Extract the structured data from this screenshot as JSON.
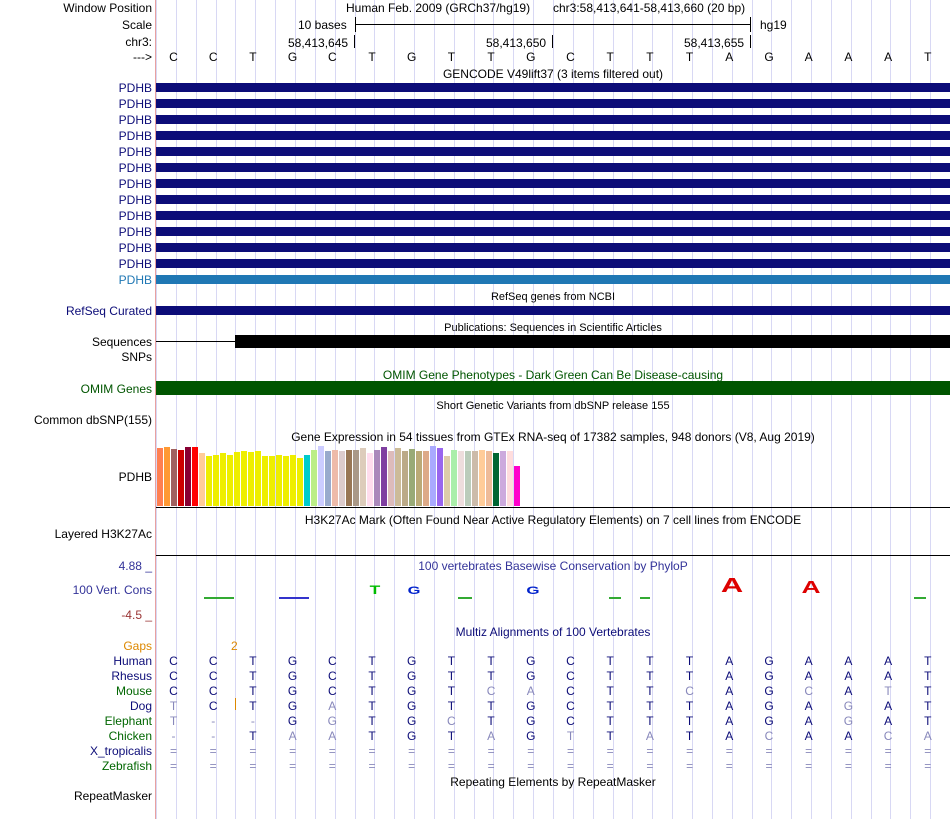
{
  "header": {
    "window_position_label": "Window Position",
    "scale_label": "Scale",
    "chr_label": "chr3:",
    "arrow_label": "--->",
    "assembly": "Human Feb. 2009 (GRCh37/hg19)",
    "region": "chr3:58,413,641-58,413,660 (20 bp)",
    "scale_text": "10 bases",
    "db": "hg19",
    "positions": [
      "58,413,645",
      "58,413,650",
      "58,413,655"
    ]
  },
  "bases": [
    "C",
    "C",
    "T",
    "G",
    "C",
    "T",
    "G",
    "T",
    "T",
    "G",
    "C",
    "T",
    "T",
    "T",
    "A",
    "G",
    "A",
    "A",
    "A",
    "T"
  ],
  "gencode": {
    "title": "GENCODE V49lift37 (3 items filtered out)",
    "items": [
      "PDHB",
      "PDHB",
      "PDHB",
      "PDHB",
      "PDHB",
      "PDHB",
      "PDHB",
      "PDHB",
      "PDHB",
      "PDHB",
      "PDHB",
      "PDHB",
      "PDHB"
    ]
  },
  "refseq": {
    "title": "RefSeq genes from NCBI",
    "label": "RefSeq Curated"
  },
  "publications": {
    "title": "Publications: Sequences in Scientific Articles",
    "label": "Sequences"
  },
  "snps": {
    "label": "SNPs"
  },
  "omim": {
    "title": "OMIM Gene Phenotypes - Dark Green Can Be Disease-causing",
    "label": "OMIM Genes"
  },
  "dbsnp": {
    "title": "Short Genetic Variants from dbSNP release 155",
    "label": "Common dbSNP(155)"
  },
  "gtex": {
    "title": "Gene Expression in 54 tissues from GTEx RNA-seq of 17382 samples, 948 donors (V8, Aug 2019)",
    "label": "PDHB",
    "bars": [
      {
        "color": "#ff7f50",
        "value": 0.93
      },
      {
        "color": "#ff9933",
        "value": 0.95
      },
      {
        "color": "#a06060",
        "value": 0.92
      },
      {
        "color": "#cc0000",
        "value": 0.9
      },
      {
        "color": "#880033",
        "value": 0.95
      },
      {
        "color": "#ff0000",
        "value": 0.95
      },
      {
        "color": "#ffcc99",
        "value": 0.85
      },
      {
        "color": "#eeee00",
        "value": 0.8
      },
      {
        "color": "#eeee00",
        "value": 0.82
      },
      {
        "color": "#eeee00",
        "value": 0.85
      },
      {
        "color": "#eeee00",
        "value": 0.82
      },
      {
        "color": "#eeee00",
        "value": 0.87
      },
      {
        "color": "#eeee00",
        "value": 0.88
      },
      {
        "color": "#eeee00",
        "value": 0.87
      },
      {
        "color": "#eeee00",
        "value": 0.88
      },
      {
        "color": "#eeee00",
        "value": 0.8
      },
      {
        "color": "#eeee00",
        "value": 0.8
      },
      {
        "color": "#eeee00",
        "value": 0.82
      },
      {
        "color": "#eeee00",
        "value": 0.8
      },
      {
        "color": "#eeee00",
        "value": 0.82
      },
      {
        "color": "#eeee00",
        "value": 0.78
      },
      {
        "color": "#00cccc",
        "value": 0.82
      },
      {
        "color": "#bbee88",
        "value": 0.9
      },
      {
        "color": "#ccccff",
        "value": 0.97
      },
      {
        "color": "#99aacc",
        "value": 0.88
      },
      {
        "color": "#eebbaa",
        "value": 0.9
      },
      {
        "color": "#ddcccc",
        "value": 0.88
      },
      {
        "color": "#997755",
        "value": 0.9
      },
      {
        "color": "#aa9988",
        "value": 0.9
      },
      {
        "color": "#ddccbb",
        "value": 0.93
      },
      {
        "color": "#ffddee",
        "value": 0.85
      },
      {
        "color": "#aa88bb",
        "value": 0.9
      },
      {
        "color": "#7f3fa0",
        "value": 0.95
      },
      {
        "color": "#ddbbbb",
        "value": 0.88
      },
      {
        "color": "#ccbb99",
        "value": 0.93
      },
      {
        "color": "#bbaa88",
        "value": 0.88
      },
      {
        "color": "#99aa77",
        "value": 0.92
      },
      {
        "color": "#bbaa77",
        "value": 0.88
      },
      {
        "color": "#ddaa88",
        "value": 0.88
      },
      {
        "color": "#aaaaff",
        "value": 0.97
      },
      {
        "color": "#9966ee",
        "value": 0.93
      },
      {
        "color": "#ddccaa",
        "value": 0.8
      },
      {
        "color": "#aaeeaa",
        "value": 0.9
      },
      {
        "color": "#eedddd",
        "value": 0.88
      },
      {
        "color": "#bbccbb",
        "value": 0.88
      },
      {
        "color": "#ccbbaa",
        "value": 0.88
      },
      {
        "color": "#ffcc99",
        "value": 0.9
      },
      {
        "color": "#eebb99",
        "value": 0.88
      },
      {
        "color": "#006633",
        "value": 0.85
      },
      {
        "color": "#ccaadd",
        "value": 0.88
      },
      {
        "color": "#ffdddd",
        "value": 0.88
      },
      {
        "color": "#ff00cc",
        "value": 0.65
      }
    ]
  },
  "h3k27ac": {
    "title": "H3K27Ac Mark (Often Found Near Active Regulatory Elements) on 7 cell lines from ENCODE",
    "label": "Layered H3K27Ac"
  },
  "phylop": {
    "title": "100 vertebrates Basewise Conservation by PhyloP",
    "label": "100 Vert. Cons",
    "max_label": "4.88 _",
    "min_label": "-4.5 _",
    "marks": [
      {
        "base": "T",
        "color": "#00bb00",
        "score": 1.2
      },
      {
        "base": "G",
        "color": "#0022cc",
        "score": 1.0
      },
      {
        "base": "G",
        "color": "#0022cc",
        "score": 1.1
      },
      {
        "base": "A",
        "color": "#dd0000",
        "score": 4.2
      },
      {
        "base": "A",
        "color": "#dd0000",
        "score": 3.2
      }
    ]
  },
  "multiz": {
    "title": "Multiz Alignments of 100 Vertebrates",
    "gaps_label": "Gaps",
    "gap_value": "2",
    "species": [
      {
        "name": "Human",
        "seq": [
          "C",
          "C",
          "T",
          "G",
          "C",
          "T",
          "G",
          "T",
          "T",
          "G",
          "C",
          "T",
          "T",
          "T",
          "A",
          "G",
          "A",
          "A",
          "A",
          "T"
        ]
      },
      {
        "name": "Rhesus",
        "seq": [
          "C",
          "C",
          "T",
          "G",
          "C",
          "T",
          "G",
          "T",
          "T",
          "G",
          "C",
          "T",
          "T",
          "T",
          "A",
          "G",
          "A",
          "A",
          "A",
          "T"
        ]
      },
      {
        "name": "Mouse",
        "seq": [
          "C",
          "C",
          "T",
          "G",
          "C",
          "T",
          "G",
          "T",
          "C",
          "A",
          "C",
          "T",
          "T",
          "C",
          "A",
          "G",
          "C",
          "A",
          "T",
          "T"
        ]
      },
      {
        "name": "Dog",
        "seq": [
          "T",
          "C",
          "T",
          "G",
          "A",
          "T",
          "G",
          "T",
          "T",
          "G",
          "C",
          "T",
          "T",
          "T",
          "A",
          "G",
          "A",
          "G",
          "A",
          "T"
        ]
      },
      {
        "name": "Elephant",
        "seq": [
          "T",
          "-",
          "-",
          "G",
          "G",
          "T",
          "G",
          "C",
          "T",
          "G",
          "C",
          "T",
          "T",
          "T",
          "A",
          "G",
          "A",
          "G",
          "A",
          "T"
        ]
      },
      {
        "name": "Chicken",
        "seq": [
          "-",
          "-",
          "T",
          "A",
          "A",
          "T",
          "G",
          "T",
          "A",
          "G",
          "T",
          "T",
          "A",
          "T",
          "A",
          "C",
          "A",
          "A",
          "C",
          "A"
        ]
      },
      {
        "name": "X_tropicalis",
        "seq": [
          "=",
          "=",
          "=",
          "=",
          "=",
          "=",
          "=",
          "=",
          "=",
          "=",
          "=",
          "=",
          "=",
          "=",
          "=",
          "=",
          "=",
          "=",
          "=",
          "="
        ]
      },
      {
        "name": "Zebrafish",
        "seq": [
          "=",
          "=",
          "=",
          "=",
          "=",
          "=",
          "=",
          "=",
          "=",
          "=",
          "=",
          "=",
          "=",
          "=",
          "=",
          "=",
          "=",
          "=",
          "=",
          "="
        ]
      }
    ]
  },
  "repeatmasker": {
    "title": "Repeating Elements by RepeatMasker",
    "label": "RepeatMasker"
  }
}
